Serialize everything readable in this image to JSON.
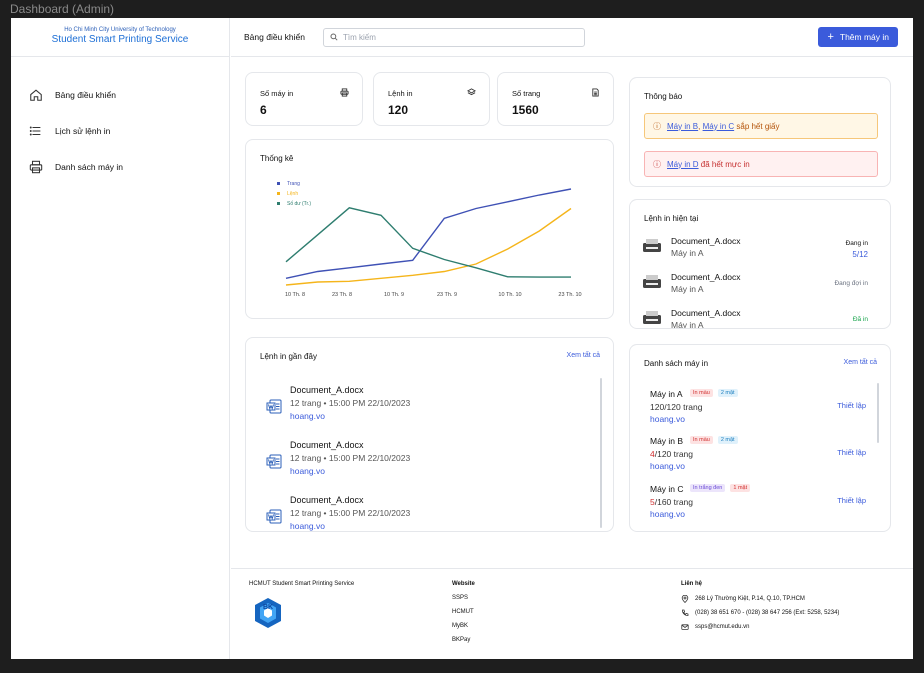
{
  "window_title": "Dashboard (Admin)",
  "brand": {
    "university": "Ho Chi Minh City University of Technology",
    "service": "Student Smart Printing Service"
  },
  "sidebar": {
    "items": [
      {
        "label": "Bảng điều khiển",
        "icon": "home-icon"
      },
      {
        "label": "Lịch sử lệnh in",
        "icon": "list-icon"
      },
      {
        "label": "Danh sách máy in",
        "icon": "printer-icon"
      }
    ]
  },
  "header": {
    "title": "Bảng điều khiển",
    "search_placeholder": "Tìm kiếm",
    "add_button": "Thêm máy in"
  },
  "stats": [
    {
      "label": "Số máy in",
      "value": "6",
      "icon": "printer-icon"
    },
    {
      "label": "Lệnh in",
      "value": "120",
      "icon": "layers-icon"
    },
    {
      "label": "Số trang",
      "value": "1560",
      "icon": "document-icon"
    }
  ],
  "chart_card": {
    "title": "Thống kê"
  },
  "chart_data": {
    "type": "line",
    "title": "Thống kê",
    "x_ticks": [
      "10 Th. 8",
      "23 Th. 8",
      "10 Th. 9",
      "23 Th. 9",
      "10 Th. 10",
      "23 Th. 10"
    ],
    "series": [
      {
        "name": "Trang",
        "color": "#3f51b5",
        "values": [
          8,
          17,
          22,
          27,
          32,
          88,
          101,
          110,
          119,
          127
        ]
      },
      {
        "name": "Lệnh",
        "color": "#f5b51b",
        "values": [
          -1,
          3,
          4,
          8,
          12,
          17,
          27,
          47,
          71,
          101
        ]
      },
      {
        "name": "Số dư (Tr.)",
        "color": "#2e7d6f",
        "values": [
          30,
          66,
          102,
          92,
          48,
          33,
          22,
          10,
          9.5,
          9.5
        ]
      }
    ],
    "ylim": [
      -5,
      135
    ],
    "grid": false,
    "legend": "top-left"
  },
  "notifications": {
    "title": "Thông báo",
    "warn": {
      "link1": "Máy in B",
      "sep": ", ",
      "link2": "Máy in C",
      "text": " sắp hết giấy"
    },
    "error": {
      "link1": "Máy in D",
      "text": " đã hết mực in"
    }
  },
  "current_jobs": {
    "title": "Lệnh in hiện tại",
    "items": [
      {
        "name": "Document_A.docx",
        "printer": "Máy in A",
        "status": "Đang in",
        "progress": "5/12",
        "status_color": "#111111"
      },
      {
        "name": "Document_A.docx",
        "printer": "Máy in A",
        "status": "Đang đợi in",
        "progress": "",
        "status_color": "#6b7280"
      },
      {
        "name": "Document_A.docx",
        "printer": "Máy in A",
        "status": "Đã in",
        "progress": "",
        "status_color": "#16a34a"
      }
    ]
  },
  "recent_jobs": {
    "title": "Lệnh in gần đây",
    "see_all": "Xem tất cả",
    "items": [
      {
        "name": "Document_A.docx",
        "meta": "12 trang • 15:00 PM 22/10/2023",
        "user": "hoang.vo"
      },
      {
        "name": "Document_A.docx",
        "meta": "12 trang • 15:00 PM 22/10/2023",
        "user": "hoang.vo"
      },
      {
        "name": "Document_A.docx",
        "meta": "12 trang • 15:00 PM 22/10/2023",
        "user": "hoang.vo"
      }
    ]
  },
  "printers": {
    "title": "Danh sách máy in",
    "see_all": "Xem tất cả",
    "setup_label": "Thiết lập",
    "items": [
      {
        "name": "Máy in A",
        "badge1": "In màu",
        "badge2": "2 mặt",
        "pages_left": "120",
        "pages_total": "/120 trang",
        "user": "hoang.vo"
      },
      {
        "name": "Máy in B",
        "badge1": "In màu",
        "badge2": "2 mặt",
        "pages_left": "4",
        "pages_total": "/120 trang",
        "user": "hoang.vo"
      },
      {
        "name": "Máy in C",
        "badge1": "In trắng đen",
        "badge2": "1 mặt",
        "pages_left": "5",
        "pages_total": "/160 trang",
        "user": "hoang.vo"
      }
    ]
  },
  "footer": {
    "brand": "HCMUT Student Smart Printing Service",
    "logo_text": "BK",
    "website": {
      "heading": "Website",
      "links": [
        "SSPS",
        "HCMUT",
        "MyBK",
        "BKPay"
      ]
    },
    "contact": {
      "heading": "Liên hệ",
      "address": "268 Lý Thường Kiệt, P.14, Q.10, TP.HCM",
      "phone": "(028) 38 651 670 - (028) 38 647 256 (Ext: 5258, 5234)",
      "email": "ssps@hcmut.edu.vn"
    }
  }
}
